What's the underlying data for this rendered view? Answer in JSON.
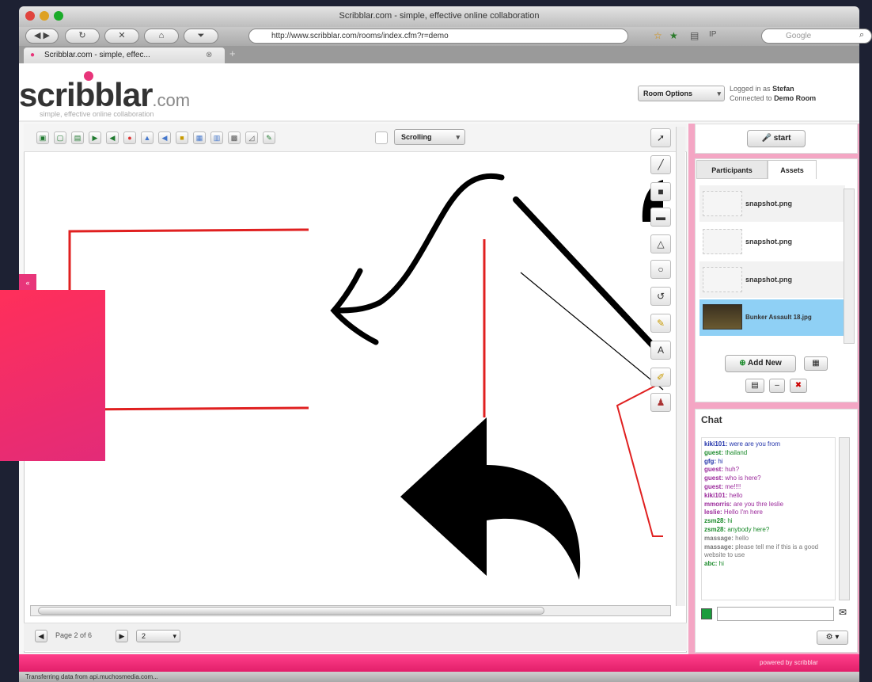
{
  "browser": {
    "window_title": "Scribblar.com - simple, effective online collaboration",
    "url": "http://www.scribblar.com/rooms/index.cfm?r=demo",
    "tab_title": "Scribblar.com - simple, effec...",
    "search_placeholder": "Google",
    "status_text": "Transferring data from api.muchosmedia.com..."
  },
  "header": {
    "logo_main": "scribblar",
    "logo_domain": ".com",
    "tagline": "simple, effective online collaboration",
    "room_options_label": "Room Options",
    "logged_in_prefix": "Logged in as",
    "user": "Stefan",
    "connected_prefix": "Connected to",
    "room": "Demo Room"
  },
  "whiteboard": {
    "scroll_mode": "Scrolling",
    "page_label": "Page 2 of 6",
    "page_select": "2"
  },
  "right_panel": {
    "start_label": "start",
    "tabs": [
      {
        "label": "Participants"
      },
      {
        "label": "Assets"
      }
    ],
    "assets": [
      {
        "name": "snapshot.png"
      },
      {
        "name": "snapshot.png"
      },
      {
        "name": "snapshot.png"
      },
      {
        "name": "Bunker Assault 18.jpg"
      }
    ],
    "add_new_label": "Add New",
    "chat_title": "Chat",
    "chat_messages": [
      {
        "user": "kiki101:",
        "text": "were are you from",
        "cls": "c-blue"
      },
      {
        "user": "guest:",
        "text": "thailand",
        "cls": "c-green"
      },
      {
        "user": "gfg:",
        "text": "hi",
        "cls": "c-blue"
      },
      {
        "user": "guest:",
        "text": "huh?",
        "cls": "c-purple"
      },
      {
        "user": "guest:",
        "text": "who is here?",
        "cls": "c-purple"
      },
      {
        "user": "guest:",
        "text": "me!!!!",
        "cls": "c-purple"
      },
      {
        "user": "kiki101:",
        "text": "hello",
        "cls": "c-purple"
      },
      {
        "user": "mmorris:",
        "text": "are you thre leslie",
        "cls": "c-purple"
      },
      {
        "user": "leslie:",
        "text": "Hello I'm here",
        "cls": "c-purple"
      },
      {
        "user": "zsm28:",
        "text": "hi",
        "cls": "c-green"
      },
      {
        "user": "zsm28:",
        "text": "anybody here?",
        "cls": "c-green"
      },
      {
        "user": "massage:",
        "text": "hello",
        "cls": "c-gray"
      },
      {
        "user": "massage:",
        "text": "please tell me if this is a good website to use",
        "cls": "c-gray"
      },
      {
        "user": "abc:",
        "text": "hi",
        "cls": "c-green"
      }
    ],
    "powered_by": "powered by scribblar"
  },
  "colors": {
    "accent_pink": "#e8357a",
    "stroke_red": "#e02020",
    "ink_black": "#000000"
  }
}
